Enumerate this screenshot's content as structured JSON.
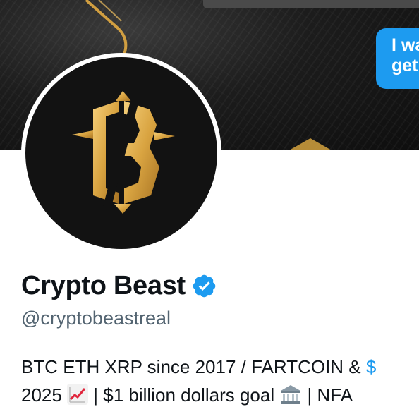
{
  "banner": {
    "bubble_line1": "I wa",
    "bubble_line2": "get"
  },
  "profile": {
    "display_name": "Crypto Beast",
    "handle": "@cryptobeastreal",
    "verified": true,
    "avatar_monogram": "CB"
  },
  "bio": {
    "line1_text": "BTC ETH XRP since 2017 / FARTCOIN & ",
    "line1_cashtag": "$",
    "line2_year": "2025 ",
    "line2_emoji1": "chart-increasing-emoji",
    "line2_mid": " | $1 billion dollars goal ",
    "line2_emoji2": "bank-emoji",
    "line2_end": " | NFA"
  },
  "colors": {
    "accent": "#1d9bf0",
    "text": "#0f1419",
    "secondary_text": "#536471",
    "gold": "#d9a441"
  }
}
